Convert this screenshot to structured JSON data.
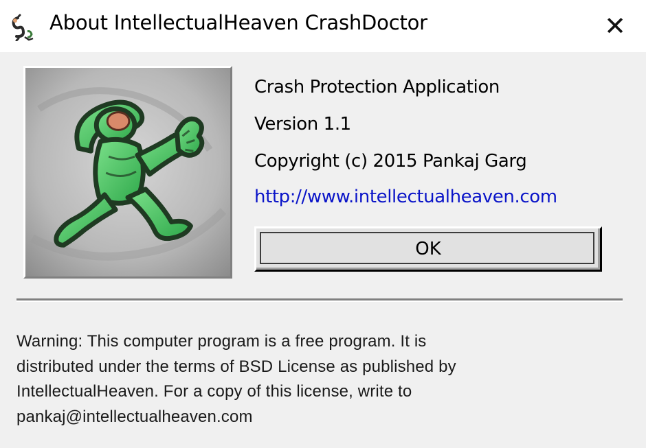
{
  "window": {
    "title": "About IntellectualHeaven CrashDoctor",
    "close_glyph": "✕",
    "app_icon": "crashdoctor-app-icon"
  },
  "logo": {
    "icon": "running-man-logo",
    "colors": {
      "figure": "#4fd06a",
      "outline": "#1f3a22",
      "face": "#d98a6a",
      "background": "#b4b4b4"
    }
  },
  "info": {
    "product": "Crash Protection Application",
    "version": "Version 1.1",
    "copyright": "Copyright (c) 2015 Pankaj Garg",
    "url": "http://www.intellectualheaven.com"
  },
  "buttons": {
    "ok_label": "OK"
  },
  "warning": {
    "text": "Warning: This computer program is a free program. It is\ndistributed under the terms of BSD License as published by\nIntellectualHeaven. For a copy of this license,  write to\npankaj@intellectualheaven.com"
  },
  "colors": {
    "link": "#0a14c8",
    "dialog_bg": "#f0f0f0",
    "titlebar_bg": "#ffffff"
  }
}
